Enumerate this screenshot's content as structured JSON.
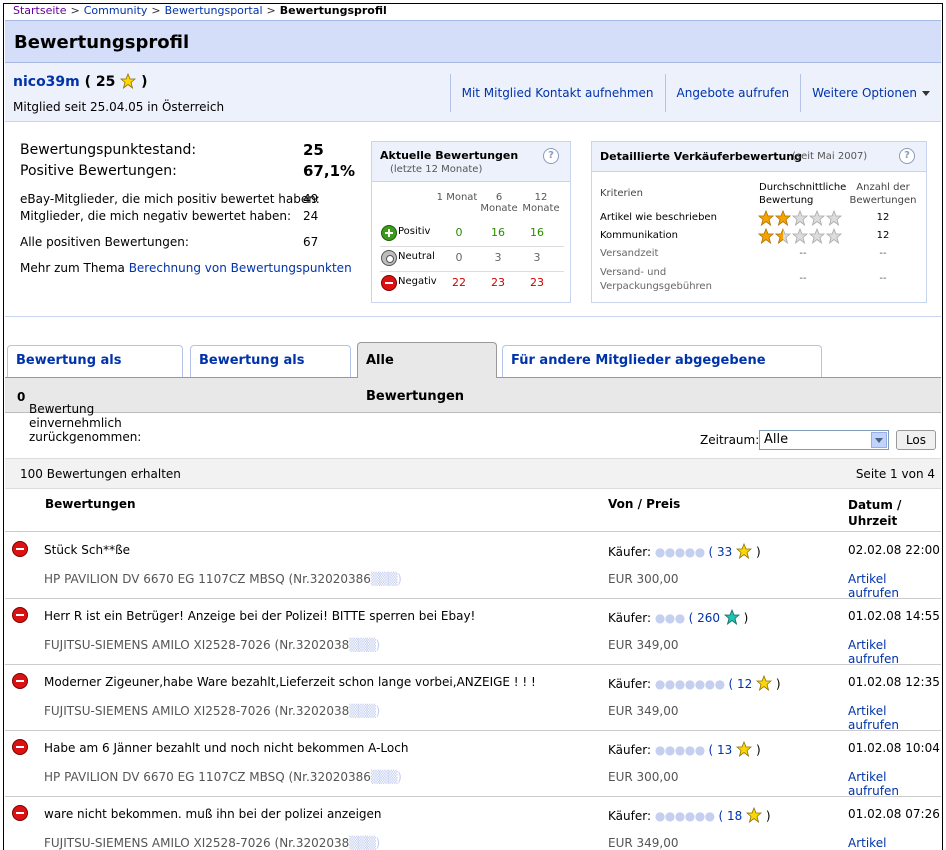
{
  "breadcrumb": [
    "Startseite",
    "Community",
    "Bewertungsportal",
    "Bewertungsprofil"
  ],
  "page": {
    "title": "Bewertungsprofil"
  },
  "user": {
    "name": "nico39m",
    "score_open": "( 25",
    "score_close": ")",
    "member_since": "Mitglied seit 25.04.05 in Österreich",
    "actions": [
      "Mit Mitglied Kontakt aufnehmen",
      "Angebote aufrufen",
      "Weitere Optionen"
    ]
  },
  "summary": {
    "score_label": "Bewertungspunktestand:",
    "score_value": "25",
    "positive_label": "Positive Bewertungen:",
    "positive_value": "67,1%",
    "pos_members_label": "eBay-Mitglieder, die mich positiv bewertet haben:",
    "pos_members_value": "49",
    "neg_members_label": "Mitglieder, die mich negativ bewertet haben:",
    "neg_members_value": "24",
    "all_pos_label": "Alle positiven Bewertungen:",
    "all_pos_value": "67",
    "more_prefix": "Mehr zum Thema",
    "more_link": "Berechnung von Bewertungspunkten"
  },
  "recent": {
    "title": "Aktuelle Bewertungen",
    "subtitle": "(letzte 12 Monate)",
    "cols": [
      "1 Monat",
      "6 Monate",
      "12 Monate"
    ],
    "rows": [
      {
        "label": "Positiv",
        "values": [
          "0",
          "16",
          "16"
        ]
      },
      {
        "label": "Neutral",
        "values": [
          "0",
          "3",
          "3"
        ]
      },
      {
        "label": "Negativ",
        "values": [
          "22",
          "23",
          "23"
        ]
      }
    ]
  },
  "detailed": {
    "title": "Detaillierte Verkäuferbewertung",
    "since": "(seit Mai 2007)",
    "h_criteria": "Kriterien",
    "h_avg": "Durchschnittliche Bewertung",
    "h_count": "Anzahl der Bewertungen",
    "rows": [
      {
        "label": "Artikel wie beschrieben",
        "rating": 2,
        "count": "12"
      },
      {
        "label": "Kommunikation",
        "rating": 1.5,
        "count": "12"
      },
      {
        "label": "Versandzeit",
        "avg_text": "--",
        "count": "--"
      },
      {
        "label": "Versand- und Verpackungsgebühren",
        "avg_text": "--",
        "count": "--"
      }
    ]
  },
  "tabs": [
    "Bewertung als Verkäufer",
    "Bewertung als Käufer",
    "Alle Bewertungen",
    "Für andere Mitglieder abgegebene Bewertung"
  ],
  "withdrawn": {
    "label": "Bewertung einvernehmlich zurückgenommen:",
    "value": "0"
  },
  "filter": {
    "label": "Zeitraum:",
    "selected": "Alle",
    "button": "Los"
  },
  "list": {
    "count_text": "100 Bewertungen erhalten",
    "page_text": "Seite 1 von 4",
    "h_feedback": "Bewertungen",
    "h_from": "Von / Preis",
    "h_date": "Datum / Uhrzeit",
    "buyer_prefix": "Käufer:",
    "view_label": "Artikel aufrufen",
    "items": [
      {
        "comment": "Stück Sch**ße",
        "item": "HP PAVILION DV 6670 EG 1107CZ MBSQ (Nr.32020386",
        "buyer_score": "33",
        "price": "EUR 300,00",
        "date": "02.02.08 22:00",
        "star": "yellow"
      },
      {
        "comment": "Herr R ist ein Betrüger! Anzeige bei der Polizei! BITTE sperren bei Ebay!",
        "item": "FUJITSU-SIEMENS AMILO XI2528-7026 (Nr.3202038",
        "buyer_score": "260",
        "price": "EUR 349,00",
        "date": "01.02.08 14:55",
        "star": "turquoise"
      },
      {
        "comment": "Moderner Zigeuner,habe Ware bezahlt,Lieferzeit schon lange vorbei,ANZEIGE ! ! !",
        "item": "FUJITSU-SIEMENS AMILO XI2528-7026 (Nr.3202038",
        "buyer_score": "12",
        "price": "EUR 349,00",
        "date": "01.02.08 12:35",
        "star": "yellow"
      },
      {
        "comment": "Habe am 6 Jänner bezahlt und noch nicht bekommen A-Loch",
        "item": "HP PAVILION DV 6670 EG 1107CZ MBSQ (Nr.32020386",
        "buyer_score": "13",
        "price": "EUR 300,00",
        "date": "01.02.08 10:04",
        "star": "yellow"
      },
      {
        "comment": "ware nicht bekommen. muß ihn bei der polizei anzeigen",
        "item": "FUJITSU-SIEMENS AMILO XI2528-7026 (Nr.3202038",
        "buyer_score": "18",
        "price": "EUR 349,00",
        "date": "01.02.08 07:26",
        "star": "yellow"
      }
    ]
  },
  "colors": {
    "link": "#0033aa",
    "title_bg": "#d4def8",
    "user_bg": "#edf1fb",
    "star_yellow": "#ffd700",
    "star_turquoise": "#22c2b4",
    "negative": "#d00000",
    "positive": "#2a8a00"
  }
}
